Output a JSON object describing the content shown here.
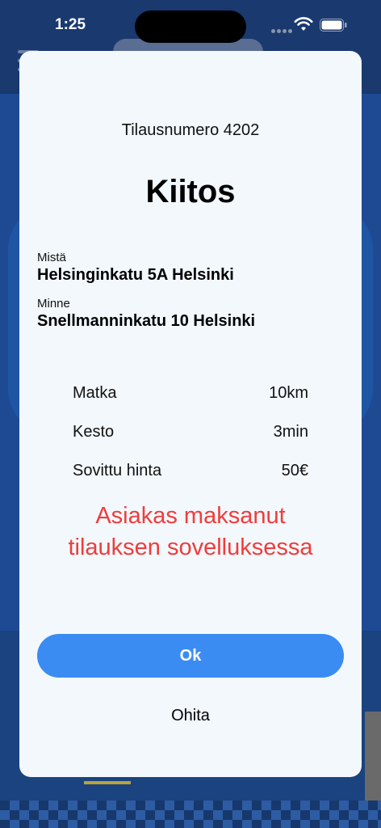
{
  "status_bar": {
    "time": "1:25",
    "icons": [
      "signal-dots-icon",
      "wifi-icon",
      "battery-icon"
    ]
  },
  "modal": {
    "order_number": "Tilausnumero 4202",
    "title": "Kiitos",
    "from": {
      "label": "Mistä",
      "value": "Helsinginkatu 5A Helsinki"
    },
    "to": {
      "label": "Minne",
      "value": "Snellmanninkatu 10 Helsinki"
    },
    "details": [
      {
        "label": "Matka",
        "value": "10km"
      },
      {
        "label": "Kesto",
        "value": "3min"
      },
      {
        "label": "Sovittu hinta",
        "value": "50€"
      }
    ],
    "payment_message": "Asiakas maksanut tilauksen sovelluksessa",
    "ok_label": "Ok",
    "skip_label": "Ohita"
  },
  "colors": {
    "modal_background": "#f2f8fc",
    "accent_button": "#3b8cf2",
    "payment_message": "#f03c3c",
    "backdrop": "#1e4a94"
  }
}
